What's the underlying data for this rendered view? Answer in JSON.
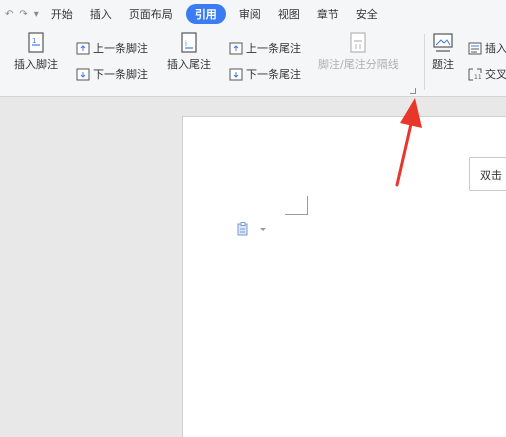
{
  "quick_access": {
    "undo": "↶",
    "redo": "↷",
    "dropdown": "▾"
  },
  "tabs": [
    "开始",
    "插入",
    "页面布局",
    "引用",
    "审阅",
    "视图",
    "章节",
    "安全"
  ],
  "ribbon": {
    "insert_footnote": "插入脚注",
    "prev_footnote": "上一条脚注",
    "next_footnote": "下一条脚注",
    "insert_endnote": "插入尾注",
    "prev_endnote": "上一条尾注",
    "next_endnote": "下一条尾注",
    "separator_line": "脚注/尾注分隔线",
    "caption": "题注",
    "insert_partial": "插入",
    "cross_ref_partial": "交叉"
  },
  "document": {
    "callout_text": "双击"
  },
  "colors": {
    "accent": "#3b7cf2",
    "arrow": "#e8362b"
  }
}
